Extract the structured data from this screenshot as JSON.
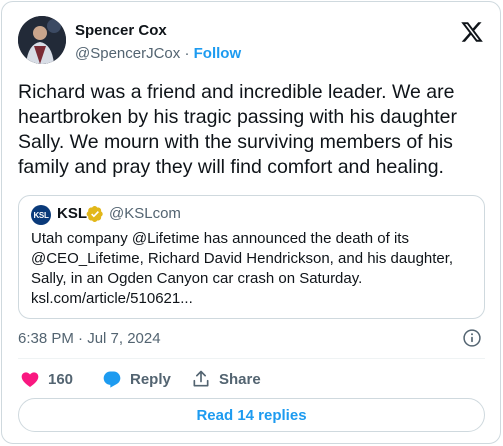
{
  "author": {
    "name": "Spencer Cox",
    "handle": "@SpencerJCox",
    "separator": " · ",
    "follow_label": "Follow"
  },
  "tweet": {
    "text": "Richard was a friend and incredible leader. We are heartbroken by his tragic passing with his daughter Sally. We  mourn with the surviving members of his family and pray they will find comfort and healing.",
    "timestamp": "6:38 PM · Jul 7, 2024"
  },
  "quote": {
    "avatar_text": "KSL",
    "name": "KSL",
    "handle": "@KSLcom",
    "text": "Utah company @Lifetime has announced the death of its @CEO_Lifetime, Richard David Hendrickson, and his daughter, Sally, in an Ogden Canyon car crash on Saturday. ksl.com/article/510621..."
  },
  "actions": {
    "like_count": "160",
    "reply_label": "Reply",
    "share_label": "Share"
  },
  "read_replies_label": "Read 14 replies",
  "colors": {
    "accent": "#1d9bf0",
    "like": "#f91880",
    "verified_gold": "#e2b719",
    "secondary_text": "#536471"
  },
  "icons": [
    "x-logo-icon",
    "verified-icon",
    "info-icon",
    "heart-icon",
    "reply-icon",
    "share-icon"
  ]
}
